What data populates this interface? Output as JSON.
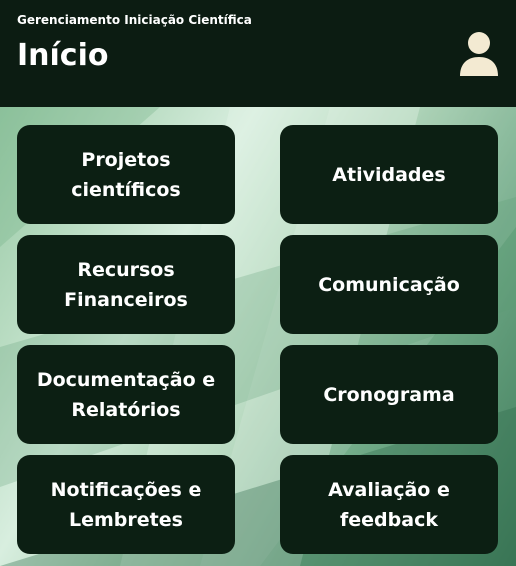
{
  "header": {
    "app_name": "Gerenciamento Iniciação Científica",
    "title": "Início",
    "user_icon": "user-icon"
  },
  "menu": {
    "projetos": "Projetos científicos",
    "atividades": "Atividades",
    "recursos_l1": "Recursos",
    "recursos_l2": "Financeiros",
    "comunicacao": "Comunicação",
    "documentacao_l1": "Documentação e",
    "documentacao_l2": "Relatórios",
    "cronograma": "Cronograma",
    "notificacoes_l1": "Notificações e",
    "notificacoes_l2": "Lembretes",
    "avaliacao_l1": "Avaliação e",
    "avaliacao_l2": "feedback"
  },
  "colors": {
    "header_bg": "#0c1c12",
    "tile_bg": "#0c1f13",
    "user_icon": "#f3ead2"
  }
}
